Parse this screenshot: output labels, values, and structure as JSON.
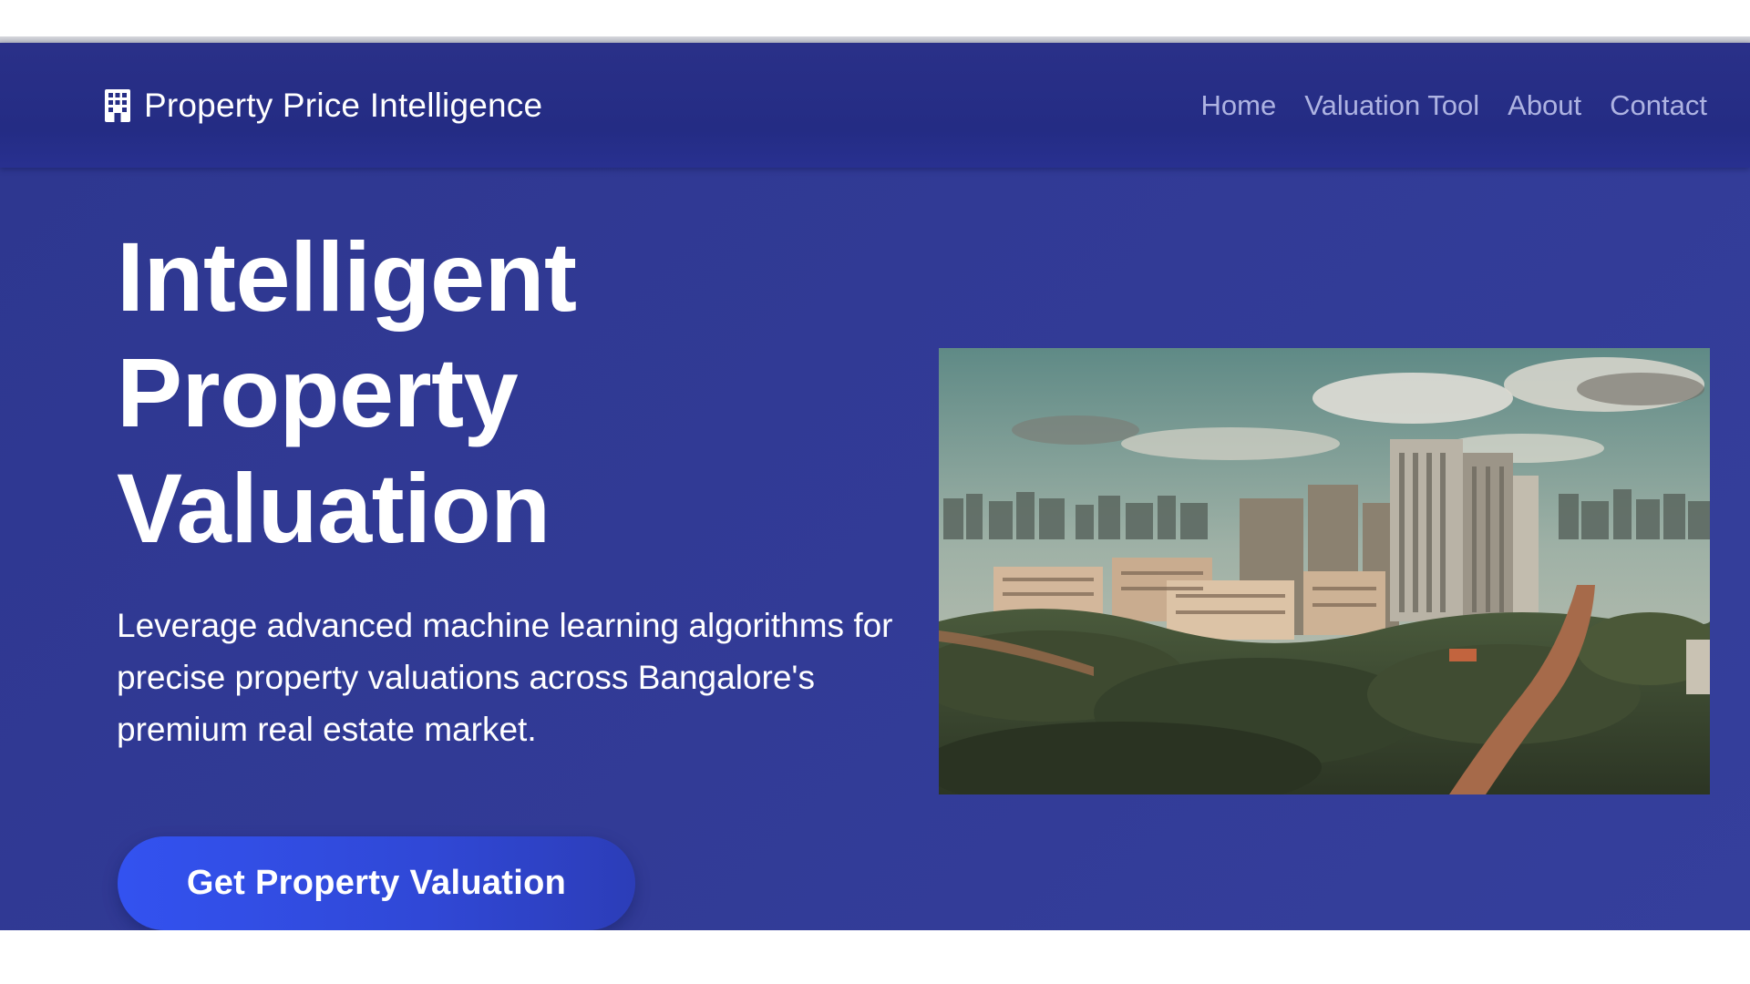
{
  "brand": {
    "name": "Property Price Intelligence",
    "icon": "building-icon"
  },
  "nav": {
    "items": [
      {
        "label": "Home"
      },
      {
        "label": "Valuation Tool"
      },
      {
        "label": "About"
      },
      {
        "label": "Contact"
      }
    ]
  },
  "hero": {
    "title": "Intelligent Property Valuation",
    "subtitle": "Leverage advanced machine learning algorithms for precise property valuations across Bangalore's premium real estate market.",
    "cta_label": "Get Property Valuation",
    "image": "bangalore-skyline-photo"
  },
  "colors": {
    "navbar": "#262e86",
    "hero_background": "#323b97",
    "nav_link": "#aeb3e2",
    "button": "#3148d8",
    "text": "#ffffff"
  }
}
